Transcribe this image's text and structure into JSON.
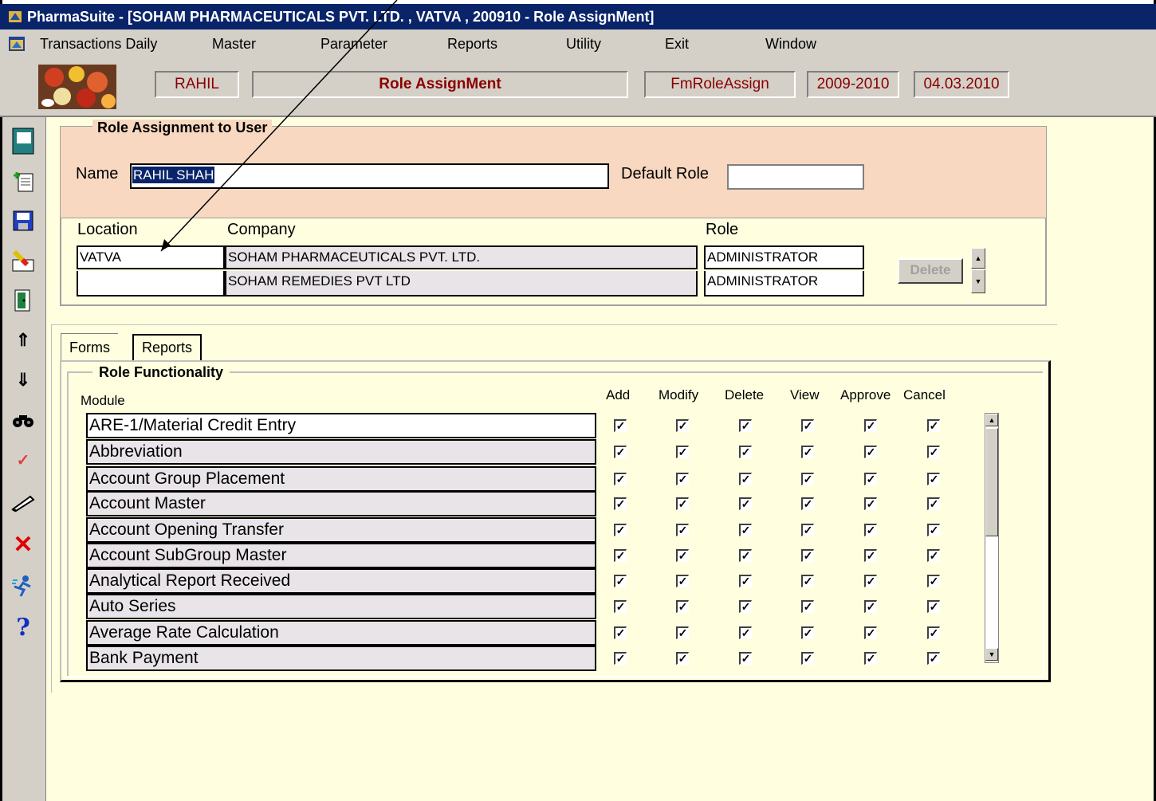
{
  "window": {
    "title": "PharmaSuite - [SOHAM PHARMACEUTICALS PVT. LTD. , VATVA , 200910 - Role AssignMent]"
  },
  "menu": [
    "Transactions Daily",
    "Master",
    "Parameter",
    "Reports",
    "Utility",
    "Exit",
    "Window"
  ],
  "header": {
    "user": "RAHIL",
    "form_title": "Role AssignMent",
    "form_code": "FmRoleAssign",
    "fin_year": "2009-2010",
    "date": "04.03.2010"
  },
  "role_assignment": {
    "section_title": "Role Assignment to User",
    "name_label": "Name",
    "name_value": "RAHIL SHAH",
    "default_role_label": "Default Role",
    "default_role_value": "",
    "col_location": "Location",
    "col_company": "Company",
    "col_role": "Role",
    "rows": [
      {
        "location": "VATVA",
        "company": "SOHAM PHARMACEUTICALS PVT. LTD.",
        "role": "ADMINISTRATOR"
      },
      {
        "location": "",
        "company": "SOHAM  REMEDIES PVT LTD",
        "role": "ADMINISTRATOR"
      }
    ],
    "delete_label": "Delete"
  },
  "tabs": [
    "Forms",
    "Reports"
  ],
  "functionality": {
    "section_title": "Role Functionality",
    "module_label": "Module",
    "columns": [
      "Add",
      "Modify",
      "Delete",
      "View",
      "Approve",
      "Cancel"
    ],
    "modules": [
      "ARE-1/Material Credit Entry",
      "Abbreviation",
      "Account Group Placement",
      "Account Master",
      "Account Opening Transfer",
      "Account SubGroup Master",
      "Analytical Report Received",
      "Auto Series",
      "Average Rate Calculation",
      "Bank Payment"
    ],
    "checked_mark": "✓"
  },
  "toolbar_icons": [
    "form-icon",
    "new-record-icon",
    "save-icon",
    "clear-icon",
    "exit-door-icon",
    "up-arrow-icon",
    "down-arrow-icon",
    "find-binoculars-icon",
    "approve-check-icon",
    "edit-pen-icon",
    "delete-x-icon",
    "run-icon",
    "help-icon"
  ],
  "colors": {
    "titlebar": "#0a246a",
    "chrome": "#d4d0c8",
    "form_bg": "#ffffe0",
    "peach_panel": "#f8d8c0",
    "header_text": "#8b0000",
    "selection": "#0a246a"
  }
}
